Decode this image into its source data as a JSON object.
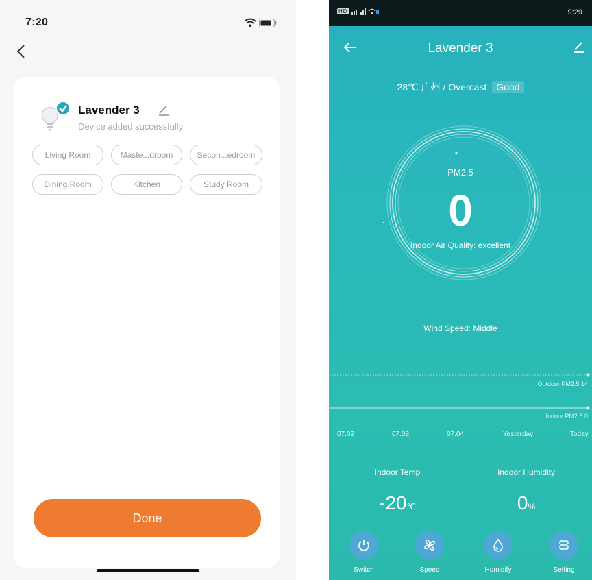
{
  "left": {
    "status_time": "7:20",
    "device_name": "Lavender 3",
    "device_status": "Device added successfully",
    "rooms": [
      "Living Room",
      "Maste...droom",
      "Secon...edroom",
      "Dining Room",
      "Kitchen",
      "Study Room"
    ],
    "done_label": "Done",
    "accent_color": "#ee7b30",
    "check_color": "#29a6b8"
  },
  "right": {
    "status_time": "9:29",
    "status_left": "HD",
    "title": "Lavender 3",
    "weather_text": "28℃ 广州 / Overcast",
    "air_quality_badge": "Good",
    "pm_label": "PM2.5",
    "pm_value": "0",
    "indoor_quality": "Indoor Air Quality: excellent",
    "wind_speed": "Wind Speed: Middle",
    "outdoor_label": "Outdoor PM2.5 14",
    "indoor_label": "Indoor PM2.5 0",
    "dates": [
      "07.02",
      "07.03",
      "07.04",
      "Yesterday",
      "Today"
    ],
    "temp_label": "Indoor Temp",
    "temp_value": "-20",
    "temp_unit": "℃",
    "humidity_label": "Indoor Humidity",
    "humidity_value": "0",
    "humidity_unit": "%",
    "controls": [
      {
        "label": "Switch",
        "icon": "power-icon"
      },
      {
        "label": "Speed",
        "icon": "fan-icon"
      },
      {
        "label": "Humidify",
        "icon": "water-drop-icon"
      },
      {
        "label": "Setting",
        "icon": "settings-icon"
      }
    ],
    "control_color": "#4ea8d6",
    "bg_color": "#2ab8bb"
  }
}
